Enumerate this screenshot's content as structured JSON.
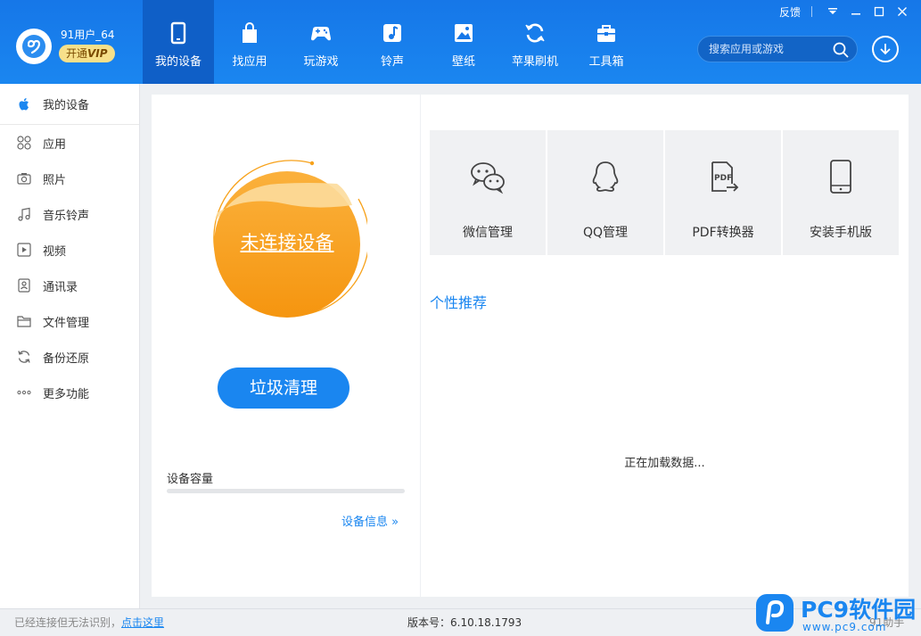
{
  "user": {
    "name": "91用户_64",
    "vip_prefix": "开通",
    "vip_tag": "VIP"
  },
  "nav": {
    "items": [
      {
        "label": "我的设备",
        "icon": "phone-icon",
        "active": true
      },
      {
        "label": "找应用",
        "icon": "bag-icon"
      },
      {
        "label": "玩游戏",
        "icon": "gamepad-icon"
      },
      {
        "label": "铃声",
        "icon": "music-note-icon"
      },
      {
        "label": "壁纸",
        "icon": "image-icon"
      },
      {
        "label": "苹果刷机",
        "icon": "refresh-icon"
      },
      {
        "label": "工具箱",
        "icon": "toolbox-icon"
      }
    ]
  },
  "search": {
    "placeholder": "搜索应用或游戏"
  },
  "window": {
    "feedback": "反馈"
  },
  "sidebar": {
    "items": [
      {
        "label": "我的设备",
        "icon": "apple-icon",
        "active": true
      },
      {
        "label": "应用",
        "icon": "apps-grid-icon"
      },
      {
        "label": "照片",
        "icon": "camera-icon"
      },
      {
        "label": "音乐铃声",
        "icon": "music-icon"
      },
      {
        "label": "视频",
        "icon": "play-icon"
      },
      {
        "label": "通讯录",
        "icon": "contacts-icon"
      },
      {
        "label": "文件管理",
        "icon": "folder-icon"
      },
      {
        "label": "备份还原",
        "icon": "sync-icon"
      },
      {
        "label": "更多功能",
        "icon": "more-dots-icon"
      }
    ]
  },
  "device": {
    "status": "未连接设备",
    "clean_button": "垃圾清理",
    "capacity_label": "设备容量",
    "capacity_used": 0,
    "info_link": "设备信息 »"
  },
  "tools": [
    {
      "label": "微信管理",
      "icon": "wechat-icon"
    },
    {
      "label": "QQ管理",
      "icon": "qq-icon"
    },
    {
      "label": "PDF转换器",
      "icon": "pdf-icon"
    },
    {
      "label": "安装手机版",
      "icon": "phone-install-icon"
    }
  ],
  "recommend": {
    "title": "个性推荐",
    "loading": "正在加载数据..."
  },
  "status_bar": {
    "left_text": "已经连接但无法识别，",
    "left_link": "点击这里",
    "version": "版本号：6.10.18.1793",
    "right_text": "91助手"
  },
  "watermark": {
    "brand": "PC9软件园",
    "url": "www.pc9.com"
  },
  "colors": {
    "accent": "#1a86f0",
    "header": "#1677e8",
    "orange": "#f7a21b"
  }
}
